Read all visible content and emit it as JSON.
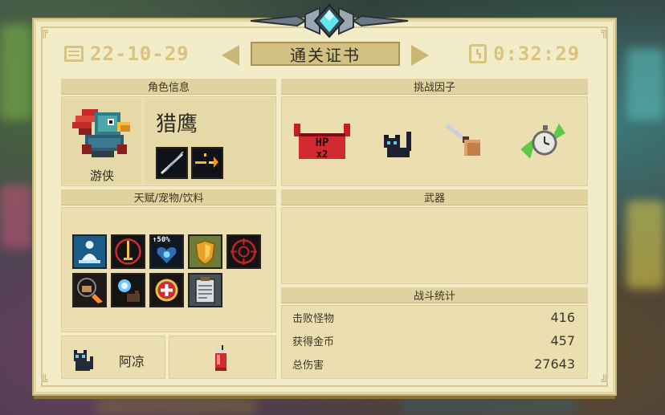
{
  "certificate": {
    "date": "22-10-29",
    "time": "0:32:29",
    "title": "通关证书"
  },
  "character": {
    "section_title": "角色信息",
    "class_name": "游侠",
    "skin_name": "猎鹰",
    "skill_icons": [
      "blade-slash-icon",
      "gun-muzzle-icon"
    ]
  },
  "challenge": {
    "section_title": "挑战因子",
    "factors": [
      "hp-x2-demon-icon",
      "black-cat-icon",
      "knife-hand-icon",
      "green-stopwatch-icon"
    ]
  },
  "talents": {
    "section_title": "天赋/宠物/饮料",
    "items": [
      "meditating-figure-icon",
      "sword-target-icon",
      "heart-up-50-percent-icon",
      "gold-shield-icon",
      "crosshair-icon",
      "hand-fireball-icon",
      "energy-orb-icon",
      "red-heart-plus-icon",
      "clipboard-icon"
    ],
    "item_badge": "50%",
    "pet_name": "阿凉",
    "pet_icon": "black-cat-pet-icon",
    "drink_icon": "red-drink-cup-icon"
  },
  "weapons": {
    "section_title": "武器"
  },
  "stats": {
    "section_title": "战斗统计",
    "rows": [
      {
        "label": "击败怪物",
        "value": "416"
      },
      {
        "label": "获得金币",
        "value": "457"
      },
      {
        "label": "总伤害",
        "value": "27643"
      }
    ]
  },
  "colors": {
    "panel": "#f3ecc9",
    "header_bar": "#e0d39f",
    "box": "#ebdfb1",
    "gold_text": "#d9c47f",
    "gem": "#5fe6ee"
  }
}
